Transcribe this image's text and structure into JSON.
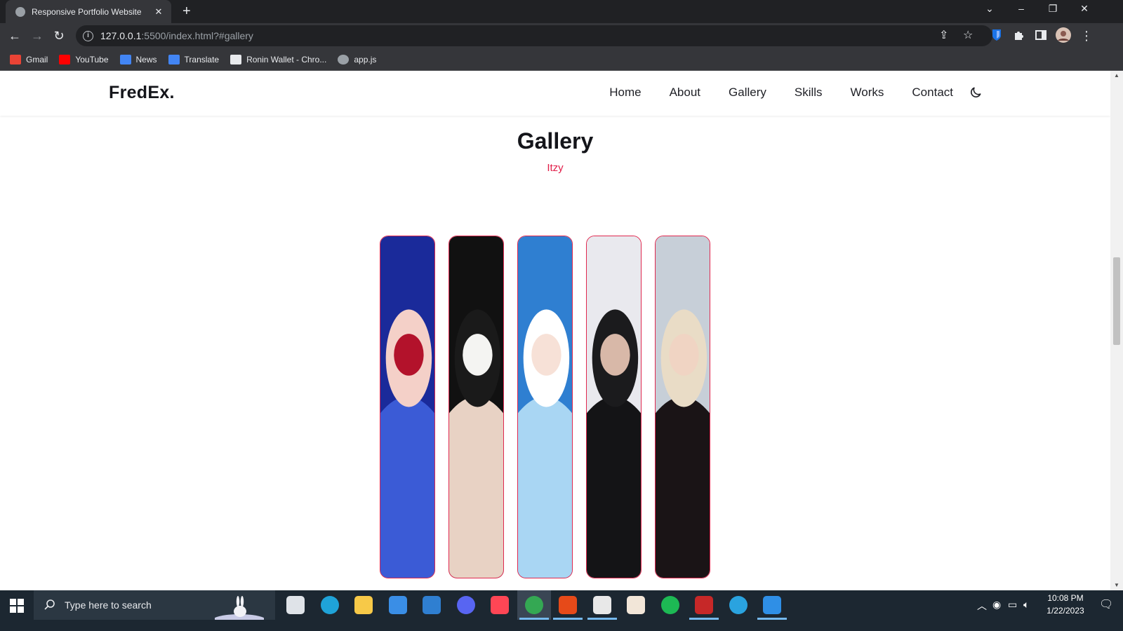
{
  "browser": {
    "tab_title": "Responsive Portfolio Website",
    "url_host": "127.0.0.1",
    "url_rest": ":5500/index.html?#gallery",
    "bookmarks": [
      {
        "label": "Gmail",
        "icon": "gmail-icon",
        "color": "#ea4335"
      },
      {
        "label": "YouTube",
        "icon": "youtube-icon",
        "color": "#ff0000"
      },
      {
        "label": "News",
        "icon": "google-news-icon",
        "color": "#4285f4"
      },
      {
        "label": "Translate",
        "icon": "google-translate-icon",
        "color": "#4285f4"
      },
      {
        "label": "Ronin Wallet - Chro...",
        "icon": "ronin-wallet-icon",
        "color": "#e8eaed"
      },
      {
        "label": "app.js",
        "icon": "globe-icon",
        "color": "#9aa0a6"
      }
    ]
  },
  "site": {
    "logo": "FredEx.",
    "nav": [
      "Home",
      "About",
      "Gallery",
      "Skills",
      "Works",
      "Contact"
    ],
    "theme_toggle_icon": "moon-icon",
    "accent": "#e11d48"
  },
  "gallery": {
    "title": "Gallery",
    "subtitle": "Itzy",
    "images": [
      {
        "name": "gallery-photo-1",
        "palette": [
          "#1a2a9a",
          "#3b5bd6",
          "#b3122b",
          "#f4d0c8"
        ]
      },
      {
        "name": "gallery-photo-2",
        "palette": [
          "#111111",
          "#e8d2c4",
          "#f4f4f2",
          "#1a1a1a"
        ]
      },
      {
        "name": "gallery-photo-3",
        "palette": [
          "#2f7fd1",
          "#a9d6f3",
          "#f7e1d7",
          "#ffffff"
        ]
      },
      {
        "name": "gallery-photo-4",
        "palette": [
          "#e9e9ee",
          "#141416",
          "#d8b8a8",
          "#1b1b1d"
        ]
      },
      {
        "name": "gallery-photo-5",
        "palette": [
          "#c7cfd8",
          "#1a1416",
          "#f0d4c3",
          "#e9dcc6"
        ]
      }
    ]
  },
  "taskbar": {
    "search_placeholder": "Type here to search",
    "time": "10:08 PM",
    "date": "1/22/2023",
    "apps": [
      {
        "name": "task-view-icon",
        "color": "#dfe3e8"
      },
      {
        "name": "edge-icon",
        "color": "#1fa3d8"
      },
      {
        "name": "file-explorer-icon",
        "color": "#f7c948"
      },
      {
        "name": "microsoft-store-icon",
        "color": "#3a8ee6"
      },
      {
        "name": "mail-icon",
        "color": "#2f7fd1"
      },
      {
        "name": "discord-icon",
        "color": "#5865f2"
      },
      {
        "name": "valorant-icon",
        "color": "#ff4655"
      },
      {
        "name": "chrome-icon",
        "color": "#34a853"
      },
      {
        "name": "office-icon",
        "color": "#e64a19"
      },
      {
        "name": "game-launcher-icon",
        "color": "#e8e8e8"
      },
      {
        "name": "anime-app-icon",
        "color": "#f2e6d8"
      },
      {
        "name": "spotify-icon",
        "color": "#1db954"
      },
      {
        "name": "game-app-icon",
        "color": "#c62828"
      },
      {
        "name": "telegram-icon",
        "color": "#2aa3df"
      },
      {
        "name": "vscode-icon",
        "color": "#2f8fe6"
      }
    ]
  }
}
